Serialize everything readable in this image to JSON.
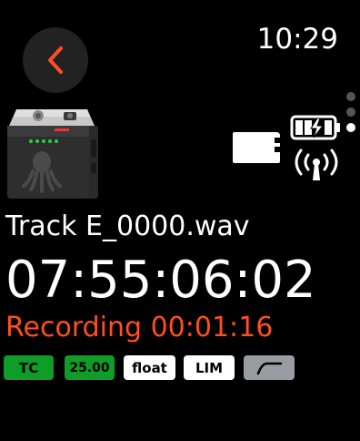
{
  "header": {
    "time": "10:29"
  },
  "icons": {
    "back": "chevron-left-icon",
    "sd_card": "sd-card-icon",
    "battery": "battery-charging-icon",
    "wireless": "wireless-antenna-icon",
    "curve": "highpass-filter-curve-icon"
  },
  "colors": {
    "accent": "#ff4e1f",
    "badge_green": "#0f9d27",
    "badge_white": "#ffffff",
    "badge_gray": "#9a9ca4"
  },
  "track": {
    "name": "Track E_0000.wav",
    "timecode": "07:55:06:02",
    "recording_label": "Recording 00:01:16"
  },
  "badges": {
    "tc": "TC",
    "frame_rate": "25.00",
    "bit_depth": "float",
    "limiter": "LIM"
  },
  "pager": {
    "total": 3,
    "active_index": 2
  }
}
